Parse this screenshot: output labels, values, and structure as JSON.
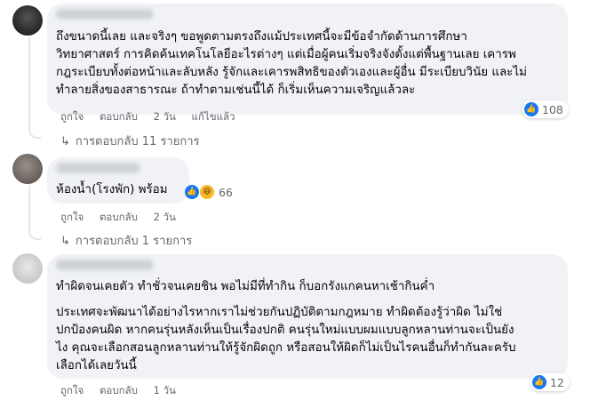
{
  "comments": [
    {
      "text": "ถึงขนาดนี้เลย และจริงๆ ขอพูดตามตรงถึงแม้ประเทศนี้จะมีข้อจำกัดด้านการศึกษา\nวิทยาศาสตร์ การคิดค้นเทคโนโลยีอะไรต่างๆ แต่เมื่อผู้คนเริ่มจริงจังตั้งแต่พื้นฐานเลย เคารพ\nกฎระเบียบทั้งต่อหน้าและลับหลัง รู้จักและเคารพสิทธิของตัวเองและผู้อื่น มีระเบียบวินัย และไม่\nทำลายสิ่งของสาธารณะ ถ้าทำตามเช่นนี้ได้ ก็เริ่มเห็นความเจริญแล้วละ",
      "actions": {
        "like": "ถูกใจ",
        "reply": "ตอบกลับ",
        "time": "2 วัน",
        "edited": "แก้ไขแล้ว"
      },
      "reaction_count": "108",
      "replies_label": "การตอบกลับ 11 รายการ"
    },
    {
      "text": "ห้องน้ำ(โรงพัก) พร้อม",
      "actions": {
        "like": "ถูกใจ",
        "reply": "ตอบกลับ",
        "time": "2 วัน"
      },
      "reaction_count": "66",
      "replies_label": "การตอบกลับ 1 รายการ"
    },
    {
      "text_p1": "ทำผิดจนเคยตัว ทำชั่วจนเคยชิน พอไม่มีที่ทำกิน ก็บอกรังแกคนหาเช้ากินค่ำ",
      "text_p2": "ประเทศจะพัฒนาได้อย่างไรหากเราไม่ช่วยกันปฏิบัติตามกฎหมาย ทำผิดต้องรู้ว่าผิด ไม่ใช่\nปกป้องคนผิด หากคนรุ่นหลังเห็นเป็นเรื่องปกติ คนรุ่นใหม่แบบผมแบบลูกหลานท่านจะเป็นยัง\nไง คุณจะเลือกสอนลูกหลานท่านให้รู้จักผิดถูก หรือสอนให้ผิดก็ไม่เป็นไรคนอื่นก็ทำกันละครับ\nเลือกได้เลยวันนี้",
      "actions": {
        "like": "ถูกใจ",
        "reply": "ตอบกลับ",
        "time": "1 วัน"
      },
      "reaction_count": "12"
    }
  ],
  "icons": {
    "like": "like-icon",
    "haha": "haha-icon",
    "reply_arrow": "reply-arrow-icon"
  },
  "colors": {
    "bubble": "#f0f2f5",
    "like_blue": "#1877f2",
    "haha_yellow": "#f7b928",
    "muted_text": "#65676b"
  }
}
